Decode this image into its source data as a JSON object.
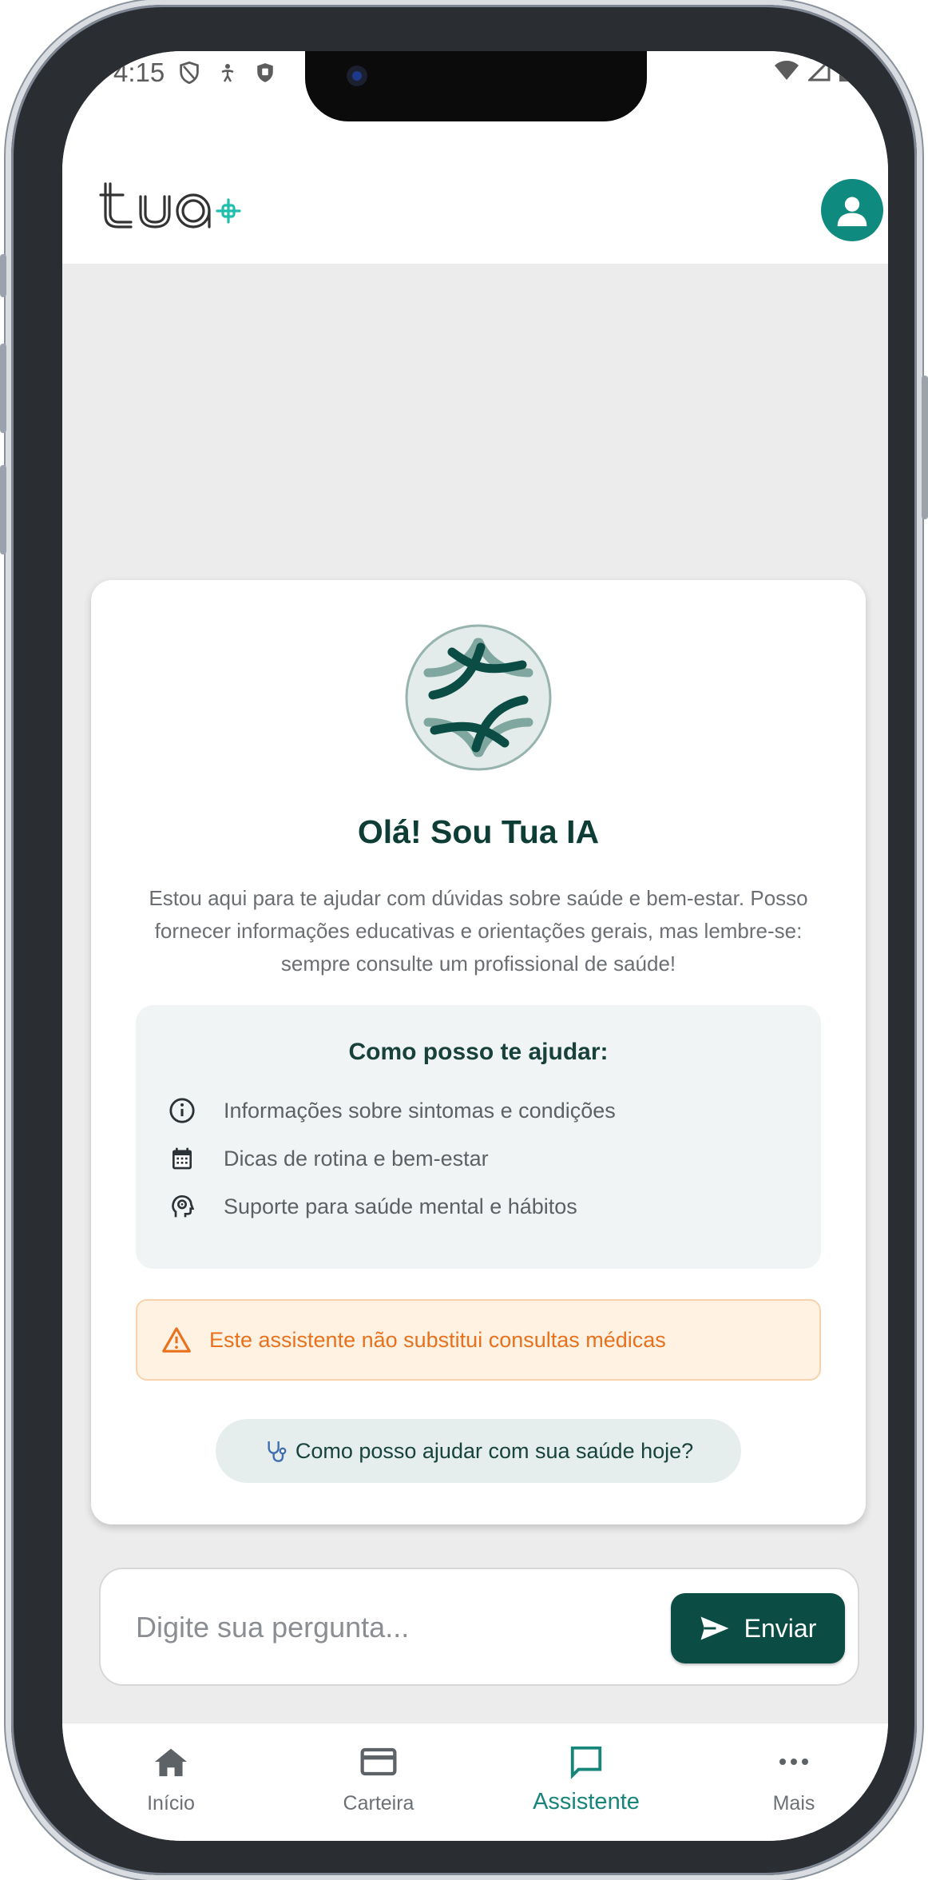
{
  "status_bar": {
    "time": "4:15"
  },
  "header": {
    "logo_text": "tua",
    "logo_accent_color": "#1fbfae",
    "avatar_color": "#0f8a7e"
  },
  "welcome": {
    "title": "Olá! Sou Tua IA",
    "description": "Estou aqui para te ajudar com dúvidas sobre saúde e bem-estar. Posso fornecer informações educativas e orientações gerais, mas lembre-se: sempre consulte um profissional de saúde!",
    "help_title": "Como posso te ajudar:",
    "help_items": [
      {
        "icon": "info-icon",
        "label": "Informações sobre sintomas e condições"
      },
      {
        "icon": "calendar-icon",
        "label": "Dicas de rotina e bem-estar"
      },
      {
        "icon": "head-mind-icon",
        "label": "Suporte para saúde mental e hábitos"
      }
    ],
    "warning": "Este assistente não substitui consultas médicas",
    "suggestion": "Como posso ajudar com sua saúde hoje?"
  },
  "input": {
    "placeholder": "Digite sua pergunta...",
    "value": "",
    "send_label": "Enviar"
  },
  "nav": {
    "items": [
      {
        "label": "Início",
        "icon": "home-icon"
      },
      {
        "label": "Carteira",
        "icon": "card-icon"
      },
      {
        "label": "Assistente",
        "icon": "chat-icon",
        "active": true
      },
      {
        "label": "Mais",
        "icon": "more-icon"
      }
    ]
  },
  "colors": {
    "primary": "#0b4d44",
    "accent": "#17857a",
    "warning": "#e8711d"
  }
}
